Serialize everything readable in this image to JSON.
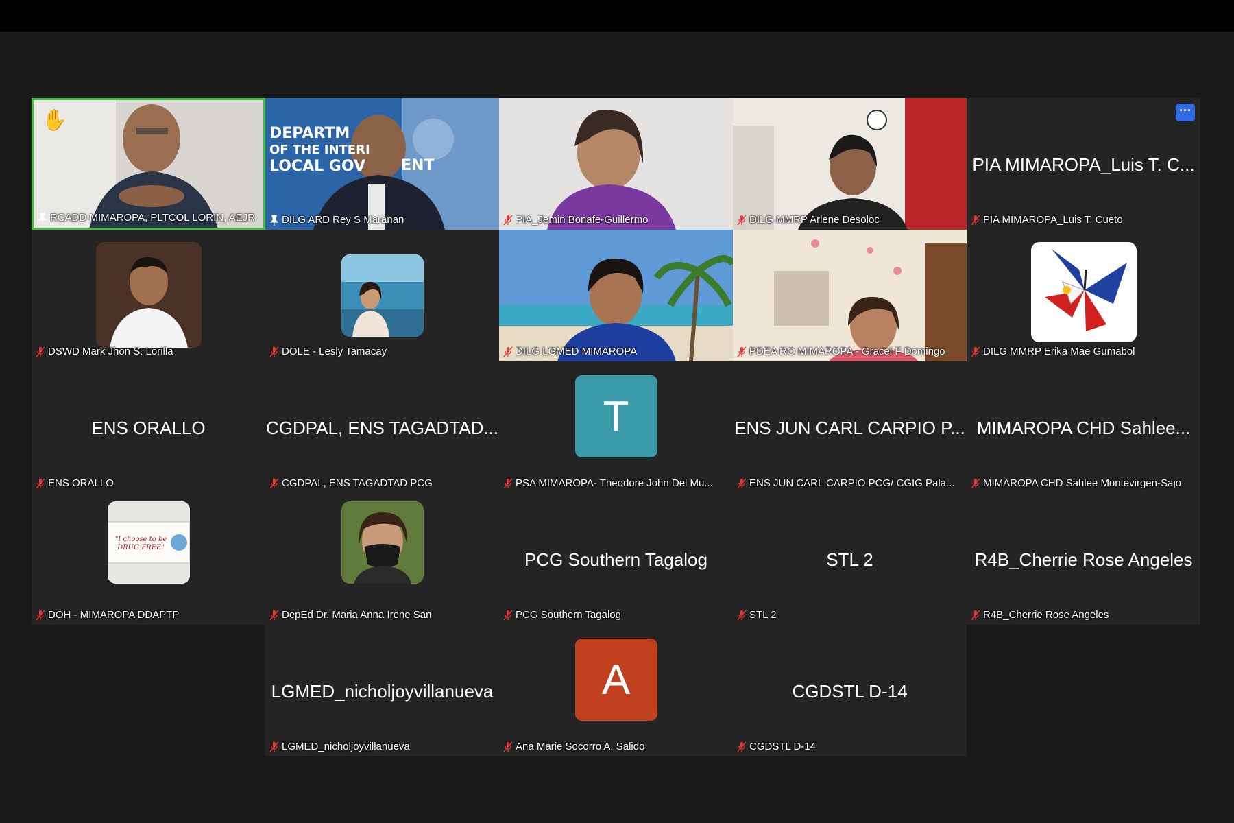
{
  "meeting": {
    "raised_hand_icon": "raised-hand-icon",
    "more_options_icon": "more-horizontal-icon",
    "more_options_label": "···",
    "muted_icon": "mic-muted-icon",
    "pinned_icon": "pin-icon",
    "accent_color": "#2d6ae3",
    "active_speaker_color": "#3fbf3f",
    "muted_color": "#e0382f"
  },
  "tiles": [
    {
      "big": "",
      "label": "RCADD MIMAROPA, PLTCOL LORIN, AEJR",
      "status": "pinned",
      "kind": "video"
    },
    {
      "big": "",
      "label": "DILG ARD Rey S Maranan",
      "status": "pinned",
      "kind": "video"
    },
    {
      "big": "",
      "label": "PIA_Jemin Bonafe-Guillermo",
      "status": "muted",
      "kind": "video"
    },
    {
      "big": "",
      "label": "DILG MMRP Arlene Desoloc",
      "status": "muted",
      "kind": "video"
    },
    {
      "big": "PIA MIMAROPA_Luis T. C...",
      "label": "PIA MIMAROPA_Luis T. Cueto",
      "status": "muted",
      "kind": "name"
    },
    {
      "big": "",
      "label": "DSWD Mark Jhon S. Lorilla",
      "status": "muted",
      "kind": "photo"
    },
    {
      "big": "",
      "label": "DOLE - Lesly Tamacay",
      "status": "muted",
      "kind": "photo"
    },
    {
      "big": "",
      "label": "DILG LGMED MIMAROPA",
      "status": "muted",
      "kind": "video"
    },
    {
      "big": "",
      "label": "PDEA RO MIMAROPA - Gracel F Domingo",
      "status": "muted",
      "kind": "video"
    },
    {
      "big": "",
      "label": "DILG MMRP Erika Mae Gumabol",
      "status": "muted",
      "kind": "photo"
    },
    {
      "big": "ENS ORALLO",
      "label": "ENS ORALLO",
      "status": "muted",
      "kind": "name"
    },
    {
      "big": "CGDPAL, ENS TAGADTAD...",
      "label": "CGDPAL, ENS TAGADTAD PCG",
      "status": "muted",
      "kind": "name"
    },
    {
      "big": "T",
      "label": "PSA MIMAROPA- Theodore John Del Mu...",
      "status": "muted",
      "kind": "letter"
    },
    {
      "big": "ENS JUN CARL CARPIO P...",
      "label": "ENS JUN CARL CARPIO PCG/ CGIG Pala...",
      "status": "muted",
      "kind": "name"
    },
    {
      "big": "MIMAROPA CHD Sahlee...",
      "label": "MIMAROPA CHD Sahlee Montevirgen-Sajo",
      "status": "muted",
      "kind": "name"
    },
    {
      "big": "\"I choose to be DRUG FREE\"",
      "label": "DOH - MIMAROPA DDAPTP",
      "status": "muted",
      "kind": "photo"
    },
    {
      "big": "",
      "label": "DepEd Dr. Maria Anna Irene San",
      "status": "muted",
      "kind": "photo"
    },
    {
      "big": "PCG Southern Tagalog",
      "label": "PCG Southern Tagalog",
      "status": "muted",
      "kind": "name"
    },
    {
      "big": "STL 2",
      "label": "STL 2",
      "status": "muted",
      "kind": "name"
    },
    {
      "big": "R4B_Cherrie Rose Angeles",
      "label": "R4B_Cherrie Rose Angeles",
      "status": "muted",
      "kind": "name"
    },
    {
      "big": "LGMED_nicholjoyvillanueva",
      "label": "LGMED_nicholjoyvillanueva",
      "status": "muted",
      "kind": "name"
    },
    {
      "big": "A",
      "label": "Ana Marie Socorro A. Salido",
      "status": "muted",
      "kind": "letter"
    },
    {
      "big": "CGDSTL D-14",
      "label": "CGDSTL D-14",
      "status": "muted",
      "kind": "name"
    }
  ],
  "video_backgrounds": {
    "dilg_banner_text_1": "DEPARTM",
    "dilg_banner_text_2": "OF THE INTERI",
    "dilg_banner_text_3": "LOCAL GOV",
    "dilg_banner_text_4": "ENT"
  },
  "letter_avatar_colors": {
    "T": "#3a9aa8",
    "A": "#c0401f"
  }
}
